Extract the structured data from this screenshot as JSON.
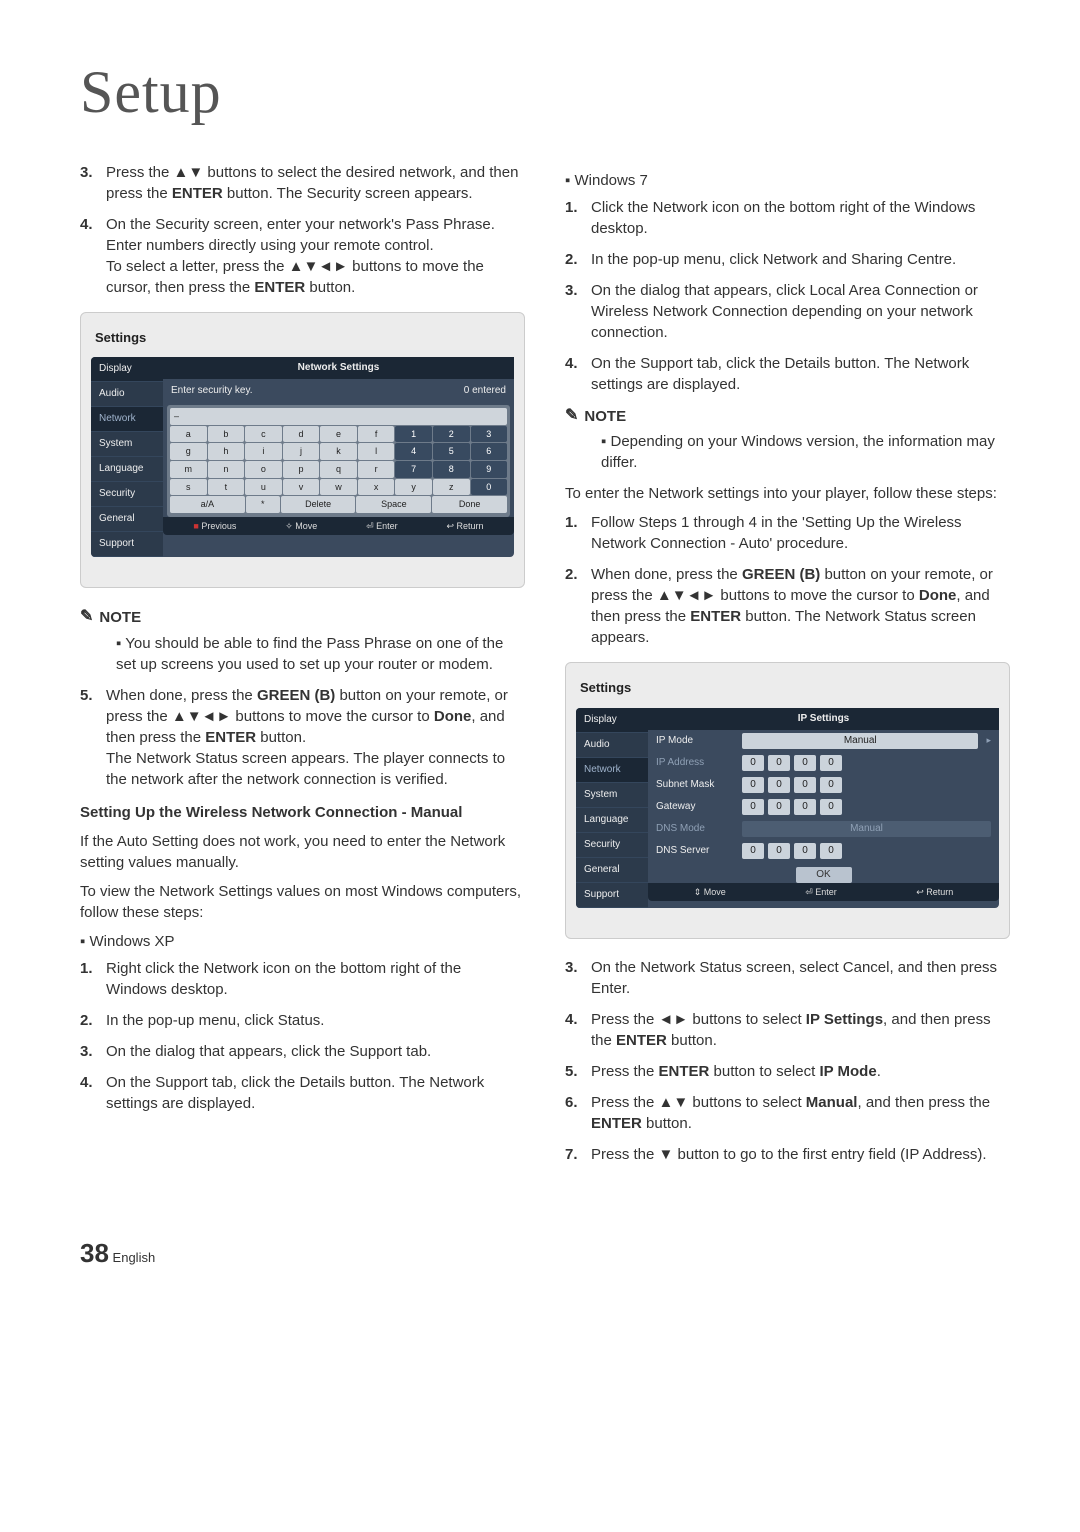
{
  "title": "Setup",
  "left": {
    "step3": {
      "n": "3.",
      "t1": "Press the ▲▼ buttons to select the desired network, and then press the ",
      "b1": "ENTER",
      "t2": " button. The Security screen appears."
    },
    "step4": {
      "n": "4.",
      "t1": "On the Security screen, enter your network's Pass Phrase. Enter numbers directly using your remote control."
    },
    "step4b": {
      "t1": "To select a letter, press the ▲▼◄► buttons to move the cursor, then press the ",
      "b1": "ENTER",
      "t2": " button."
    },
    "note_label": "NOTE",
    "note1": "You should be able to find the Pass Phrase on one of the set up screens you used to set up your router or modem.",
    "step5": {
      "n": "5.",
      "t1": "When done, press the ",
      "b1": "GREEN (B)",
      "t2": " button on your remote, or press the ▲▼◄► buttons to move the cursor to ",
      "b2": "Done",
      "t3": ", and then press the ",
      "b3": "ENTER",
      "t4": " button."
    },
    "step5b": "The Network Status screen appears. The player connects to the network after the network connection is verified.",
    "subhead": "Setting Up the Wireless Network Connection - Manual",
    "para1": "If the Auto Setting does not work, you need to enter the Network setting values manually.",
    "para2": "To view the Network Settings values on most Windows computers, follow these steps:",
    "winxp": "Windows XP",
    "xp1": {
      "n": "1.",
      "t": "Right click the Network icon on the bottom right of the Windows desktop."
    },
    "xp2": {
      "n": "2.",
      "t": "In the pop-up menu, click Status."
    },
    "xp3": {
      "n": "3.",
      "t": "On the dialog that appears, click the Support tab."
    },
    "xp4": {
      "n": "4.",
      "t": "On the Support tab, click the Details button. The Network settings are displayed."
    }
  },
  "right": {
    "win7": "Windows 7",
    "w1": {
      "n": "1.",
      "t": "Click the Network icon on the bottom right of the Windows desktop."
    },
    "w2": {
      "n": "2.",
      "t": "In the pop-up menu, click Network and Sharing Centre."
    },
    "w3": {
      "n": "3.",
      "t": "On the dialog that appears, click Local Area Connection or Wireless Network Connection depending on your network connection."
    },
    "w4": {
      "n": "4.",
      "t": "On the Support tab, click the Details button. The Network settings are displayed."
    },
    "note_label": "NOTE",
    "note1": "Depending on your Windows version, the information may differ.",
    "para3": "To enter the Network settings into your player, follow these steps:",
    "s1": {
      "n": "1.",
      "t": "Follow Steps 1 through 4 in the 'Setting Up the Wireless Network Connection - Auto' procedure."
    },
    "s2": {
      "n": "2.",
      "t1": "When done, press the ",
      "b1": "GREEN (B)",
      "t2": " button on your remote, or press the ▲▼◄► buttons to move the cursor to ",
      "b2": "Done",
      "t3": ", and then press the ",
      "b3": "ENTER",
      "t4": " button. The Network Status screen appears."
    },
    "s3": {
      "n": "3.",
      "t": "On the Network Status screen, select Cancel, and then press Enter."
    },
    "s4": {
      "n": "4.",
      "t1": "Press the ◄► buttons to select ",
      "b1": "IP Settings",
      "t2": ", and then press the ",
      "b2": "ENTER",
      "t3": " button."
    },
    "s5": {
      "n": "5.",
      "t1": "Press the ",
      "b1": "ENTER",
      "t2": " button to select ",
      "b2": "IP Mode",
      "t3": "."
    },
    "s6": {
      "n": "6.",
      "t1": "Press the ▲▼ buttons to select ",
      "b1": "Manual",
      "t2": ", and then press the ",
      "b2": "ENTER",
      "t3": " button."
    },
    "s7": {
      "n": "7.",
      "t": "Press the ▼ button to go to the first entry field (IP Address)."
    }
  },
  "panel1": {
    "title": "Settings",
    "sidebar": [
      "Display",
      "Audio",
      "Network",
      "System",
      "Language",
      "Security",
      "General",
      "Support"
    ],
    "header": "Network Settings",
    "prompt": "Enter security key.",
    "entered": "0 entered",
    "rows": [
      [
        "a",
        "b",
        "c",
        "d",
        "e",
        "f",
        "1",
        "2",
        "3"
      ],
      [
        "g",
        "h",
        "i",
        "j",
        "k",
        "l",
        "4",
        "5",
        "6"
      ],
      [
        "m",
        "n",
        "o",
        "p",
        "q",
        "r",
        "7",
        "8",
        "9"
      ],
      [
        "s",
        "t",
        "u",
        "v",
        "w",
        "x",
        "y",
        "z",
        "0"
      ]
    ],
    "lastrow": [
      "a/A",
      "",
      "Delete",
      "Space",
      "Done"
    ],
    "actions": {
      "a": "Previous",
      "m": "Move",
      "e": "Enter",
      "r": "Return"
    }
  },
  "panel2": {
    "title": "Settings",
    "sidebar": [
      "Display",
      "Audio",
      "Network",
      "System",
      "Language",
      "Security",
      "General",
      "Support"
    ],
    "header": "IP Settings",
    "rows": [
      {
        "lbl": "IP Mode",
        "type": "val",
        "val": "Manual"
      },
      {
        "lbl": "IP Address",
        "type": "ip",
        "vals": [
          "0",
          "0",
          "0",
          "0"
        ],
        "dim": true
      },
      {
        "lbl": "Subnet Mask",
        "type": "ip",
        "vals": [
          "0",
          "0",
          "0",
          "0"
        ]
      },
      {
        "lbl": "Gateway",
        "type": "ip",
        "vals": [
          "0",
          "0",
          "0",
          "0"
        ]
      },
      {
        "lbl": "DNS Mode",
        "type": "val",
        "val": "Manual",
        "dim": true
      },
      {
        "lbl": "DNS Server",
        "type": "ip",
        "vals": [
          "0",
          "0",
          "0",
          "0"
        ]
      }
    ],
    "ok": "OK",
    "actions": {
      "m": "Move",
      "e": "Enter",
      "r": "Return"
    }
  },
  "footer": {
    "page": "38",
    "lang": "English"
  }
}
